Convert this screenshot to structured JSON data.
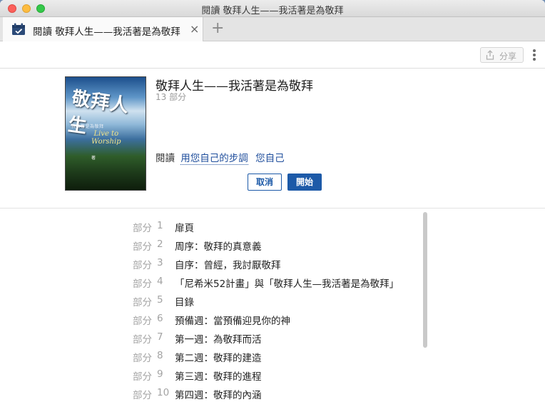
{
  "window": {
    "title": "閱讀 敬拜人生——我活著是為敬拜"
  },
  "tab": {
    "label": "閱讀 敬拜人生——我活著是為敬拜",
    "close": "×",
    "add": "+"
  },
  "toolbar": {
    "share_label": "分享"
  },
  "book": {
    "title": "敬拜人生——我活著是為敬拜",
    "parts": "13 部分",
    "read_prefix": "閱讀",
    "read_link_1": "用您自己的步調",
    "read_link_2": "您自己",
    "cancel_label": "取消",
    "start_label": "開始"
  },
  "toc": {
    "prefix": "部分",
    "items": [
      {
        "num": "1",
        "title": "扉頁"
      },
      {
        "num": "2",
        "title": "周序：敬拜的真意義"
      },
      {
        "num": "3",
        "title": "自序：曾經，我討厭敬拜"
      },
      {
        "num": "4",
        "title": "「尼希米52計畫」與「敬拜人生—我活著是為敬拜」"
      },
      {
        "num": "5",
        "title": "目錄"
      },
      {
        "num": "6",
        "title": "預備週：當預備迎見你的神"
      },
      {
        "num": "7",
        "title": "第一週：為敬拜而活"
      },
      {
        "num": "8",
        "title": "第二週：敬拜的建造"
      },
      {
        "num": "9",
        "title": "第三週：敬拜的進程"
      },
      {
        "num": "10",
        "title": "第四週：敬拜的內涵"
      }
    ]
  },
  "icons": {
    "tab": "calendar-check-icon",
    "share": "share-upload-icon",
    "more": "more-vertical-icon"
  },
  "colors": {
    "accent": "#1d5aa8",
    "link": "#1f4e9c",
    "muted": "#a3a3a3"
  }
}
